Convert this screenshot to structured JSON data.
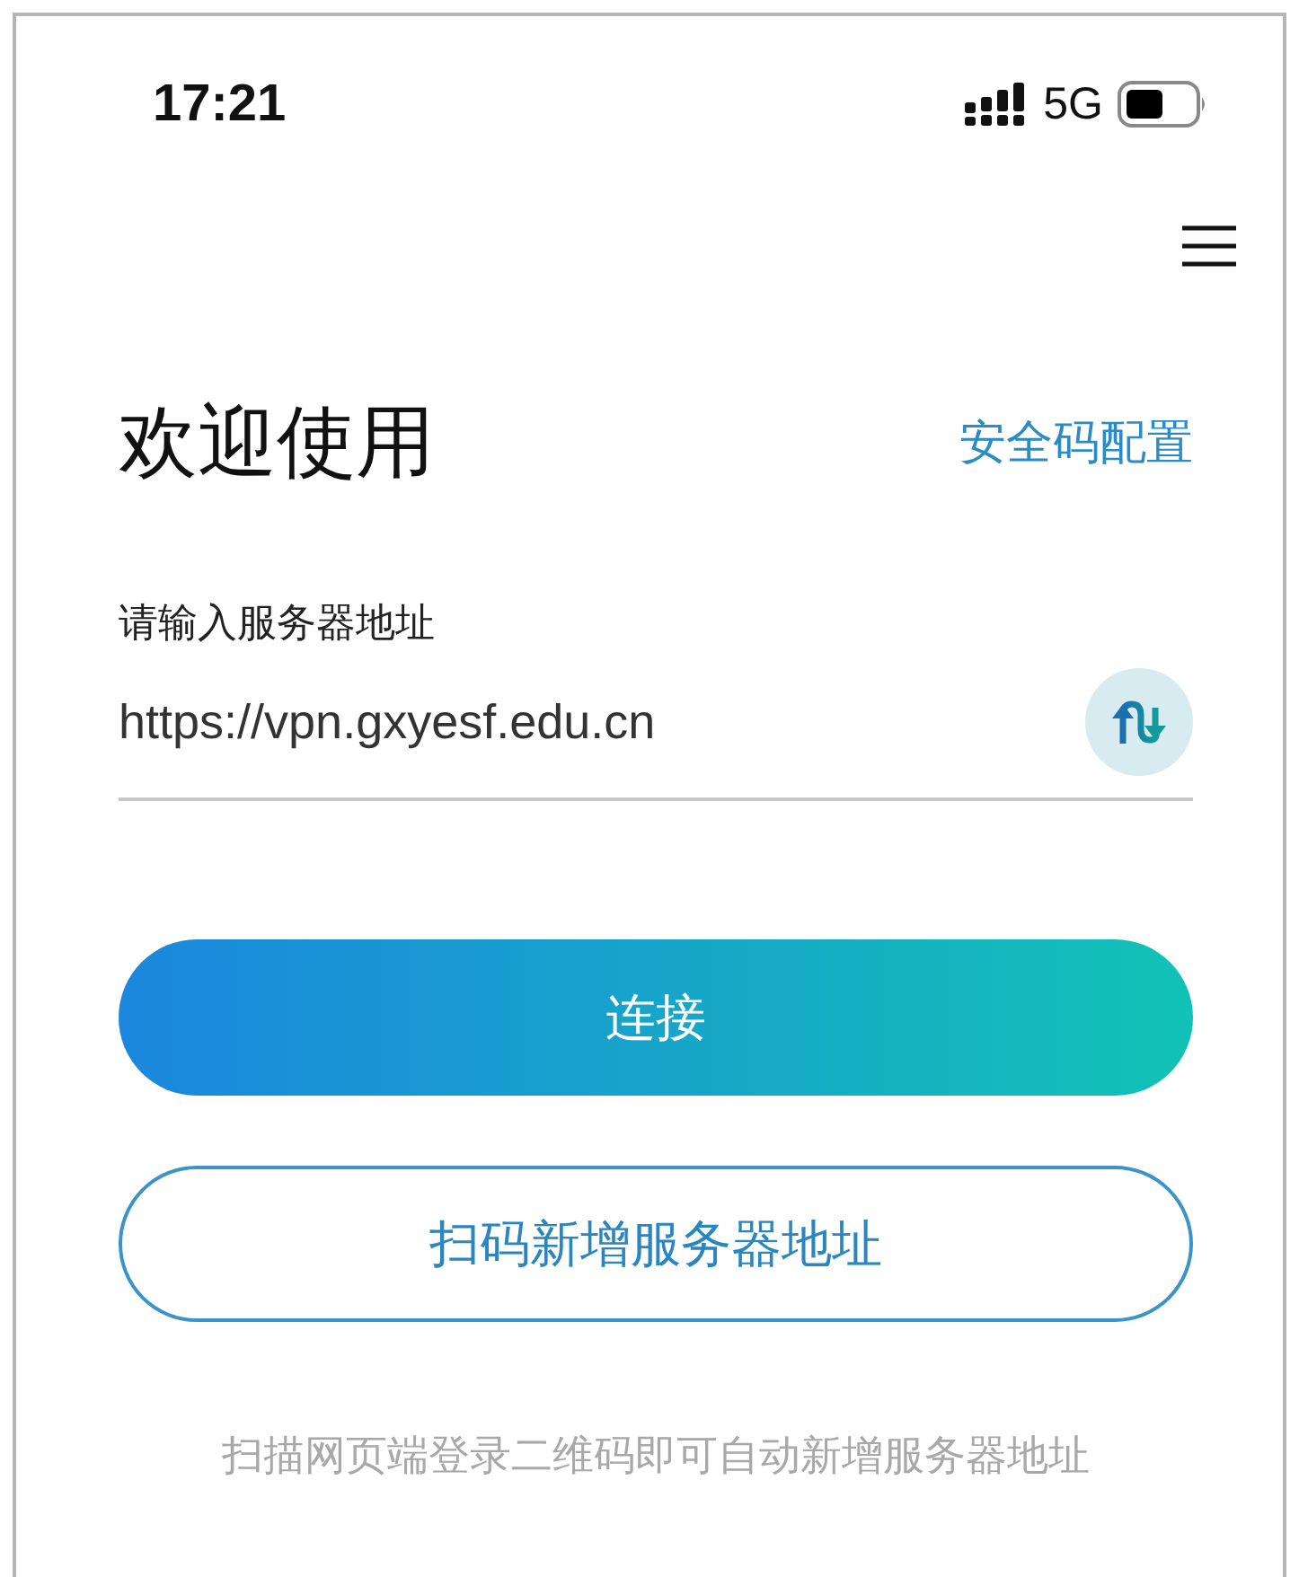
{
  "status_bar": {
    "time": "17:21",
    "network": "5G"
  },
  "header": {
    "title": "欢迎使用",
    "security_link": "安全码配置"
  },
  "server_field": {
    "label": "请输入服务器地址",
    "value": "https://vpn.gxyesf.edu.cn"
  },
  "buttons": [
    {
      "kind": "primary",
      "label": "连接"
    },
    {
      "kind": "outline",
      "label": "扫码新增服务器地址"
    }
  ],
  "hint": "扫描网页端登录二维码即可自动新增服务器地址"
}
